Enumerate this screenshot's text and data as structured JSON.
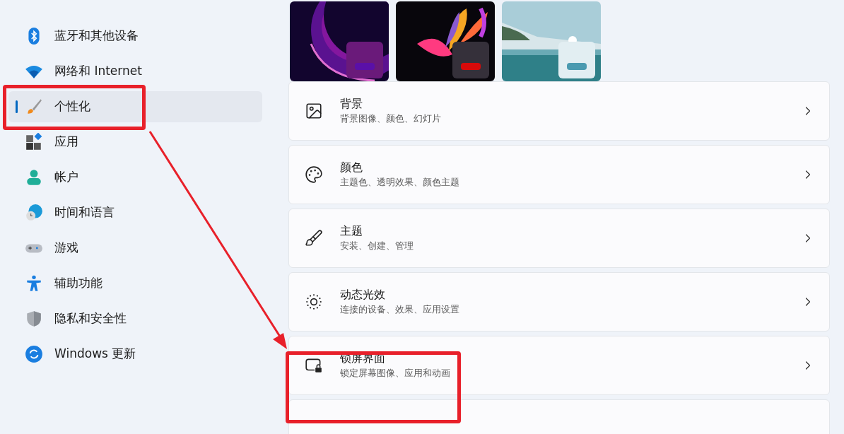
{
  "sidebar": {
    "items": [
      {
        "label": "蓝牙和其他设备",
        "selected": false
      },
      {
        "label": "网络和 Internet",
        "selected": false
      },
      {
        "label": "个性化",
        "selected": true
      },
      {
        "label": "应用",
        "selected": false
      },
      {
        "label": "帐户",
        "selected": false
      },
      {
        "label": "时间和语言",
        "selected": false
      },
      {
        "label": "游戏",
        "selected": false
      },
      {
        "label": "辅助功能",
        "selected": false
      },
      {
        "label": "隐私和安全性",
        "selected": false
      },
      {
        "label": "Windows 更新",
        "selected": false
      }
    ]
  },
  "themes": [
    {
      "color": "#5a10a8"
    },
    {
      "color": "#d80a0a"
    },
    {
      "color": "#4a9ab0"
    }
  ],
  "settings": [
    {
      "title": "背景",
      "subtitle": "背景图像、颜色、幻灯片"
    },
    {
      "title": "颜色",
      "subtitle": "主题色、透明效果、颜色主题"
    },
    {
      "title": "主题",
      "subtitle": "安装、创建、管理"
    },
    {
      "title": "动态光效",
      "subtitle": "连接的设备、效果、应用设置"
    },
    {
      "title": "锁屏界面",
      "subtitle": "锁定屏幕图像、应用和动画"
    }
  ]
}
